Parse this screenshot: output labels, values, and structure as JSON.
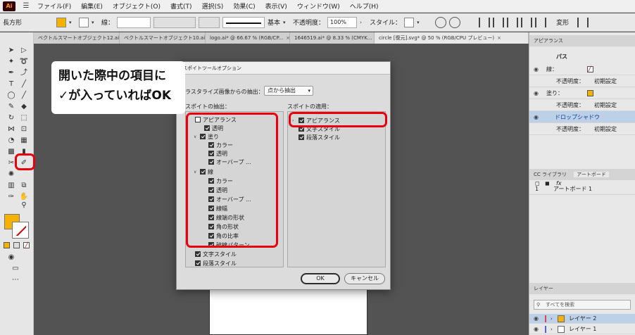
{
  "menu": {
    "items": [
      "ファイル(F)",
      "編集(E)",
      "オブジェクト(O)",
      "書式(T)",
      "選択(S)",
      "効果(C)",
      "表示(V)",
      "ウィンドウ(W)",
      "ヘルプ(H)"
    ]
  },
  "control_bar": {
    "object_type": "長方形",
    "stroke_label": "線：",
    "brush_label": "基本",
    "opacity_label": "不透明度：",
    "opacity_value": "100%",
    "style_label": "スタイル：",
    "transform_label": "変形",
    "fill_color": "#f5b300"
  },
  "tabs": [
    {
      "label": "ベクトルスマートオブジェクト12.ai"
    },
    {
      "label": "ベクトルスマートオブジェクト10.ai"
    },
    {
      "label": "logo.ai* @ 66.67 % (RGB/CP..."
    },
    {
      "label": "1646519.ai* @ 8.33 % (CMYK..."
    },
    {
      "label": "circle [復元].svg* @ 50 % (RGB/CPU プレビュー)"
    }
  ],
  "appearance_panel": {
    "title": "アピアランス",
    "object": "パス",
    "rows": [
      {
        "label": "線：",
        "value": ""
      },
      {
        "label": "不透明度：",
        "value": "初期設定"
      },
      {
        "label": "塗り：",
        "value": ""
      },
      {
        "label": "不透明度：",
        "value": "初期設定"
      },
      {
        "label": "ドロップシャドウ",
        "value": ""
      },
      {
        "label": "不透明度：",
        "value": "初期設定"
      }
    ]
  },
  "artboard_panel": {
    "tab_library": "CC ライブラリ",
    "tab_artboard": "アートボード",
    "row_number": "1",
    "row_name": "アートボード 1"
  },
  "layers_panel": {
    "title": "レイヤー",
    "search_placeholder": "すべてを検索",
    "layers": [
      "レイヤー 2",
      "レイヤー 1"
    ]
  },
  "dialog": {
    "title": "スポイトツールオプション",
    "raster_label": "ラスタライズ画像からの抽出：",
    "raster_value": "点から抽出",
    "pickup_label": "スポイトの抽出：",
    "apply_label": "スポイトの適用：",
    "pickup_items": [
      {
        "label": "アピアランス",
        "checked": false
      },
      {
        "label": "透明",
        "checked": true
      },
      {
        "label": "塗り",
        "checked": true
      },
      {
        "label": "カラー",
        "checked": true
      },
      {
        "label": "透明",
        "checked": true
      },
      {
        "label": "オーバープ ...",
        "checked": true
      },
      {
        "label": "線",
        "checked": true
      },
      {
        "label": "カラー",
        "checked": true
      },
      {
        "label": "透明",
        "checked": true
      },
      {
        "label": "オーバープ ...",
        "checked": true
      },
      {
        "label": "線幅",
        "checked": true
      },
      {
        "label": "線端の形状",
        "checked": true
      },
      {
        "label": "角の形状",
        "checked": true
      },
      {
        "label": "角の比率",
        "checked": true
      },
      {
        "label": "破線パターン",
        "checked": true
      },
      {
        "label": "文字スタイル",
        "checked": true
      },
      {
        "label": "段落スタイル",
        "checked": true
      }
    ],
    "apply_items": [
      {
        "label": "アピアランス",
        "checked": true
      },
      {
        "label": "文字スタイル",
        "checked": true
      },
      {
        "label": "段落スタイル",
        "checked": true
      }
    ],
    "ok_label": "OK",
    "cancel_label": "キャンセル"
  },
  "callout": {
    "line1": "開いた際中の項目に",
    "line2": "✓が入っていればOK"
  },
  "colors": {
    "highlight": "#e8000f",
    "selection": "#bcd0e8",
    "layer_color": "#f5b300"
  }
}
